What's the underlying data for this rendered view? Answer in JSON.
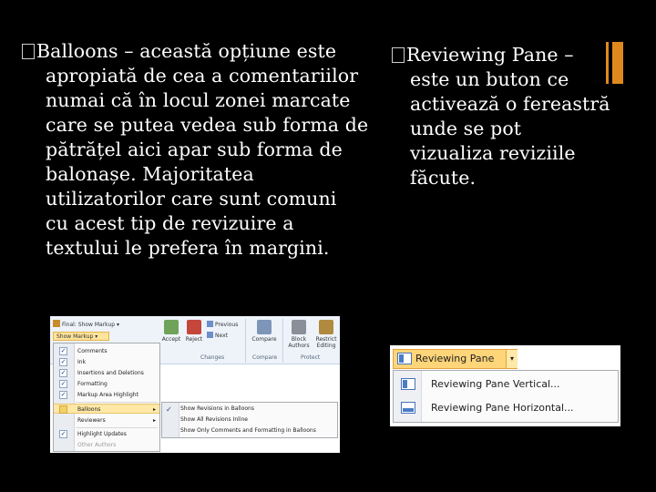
{
  "colors": {
    "background": "#000000",
    "accent": "#e08a1e",
    "text": "#ffffff"
  },
  "left_block": {
    "lines": [
      "Balloons – această opțiune este",
      "apropiată de cea a comentariilor",
      "numai că în locul zonei marcate",
      "care se putea vedea sub forma de",
      "pătrățel aici apar sub forma de",
      "balonașe. Majoritatea",
      "utilizatorilor care sunt comuni",
      "cu acest tip de  revizuire a",
      "textului le prefera în margini."
    ]
  },
  "right_block": {
    "lines": [
      "Reviewing Pane –",
      "este un buton ce",
      "activează o fereastră",
      "unde se pot",
      "vizualiza reviziile",
      "făcute."
    ]
  },
  "shot1": {
    "final_show_markup": "Final: Show Markup",
    "show_markup": "Show Markup",
    "ribbon_buttons": {
      "accept": "Accept",
      "reject": "Reject",
      "previous": "Previous",
      "next": "Next",
      "compare": "Compare",
      "block_authors": "Block Authors",
      "restrict_editing": "Restrict Editing"
    },
    "group_labels": {
      "changes": "Changes",
      "compare": "Compare",
      "protect": "Protect"
    },
    "menu_items": [
      {
        "label": "Comments",
        "checked": true
      },
      {
        "label": "Ink",
        "checked": true
      },
      {
        "label": "Insertions and Deletions",
        "checked": true
      },
      {
        "label": "Formatting",
        "checked": true
      },
      {
        "label": "Markup Area Highlight",
        "checked": true
      },
      {
        "label": "Balloons",
        "checked": false
      },
      {
        "label": "Reviewers",
        "checked": false
      },
      {
        "label": "Highlight Updates",
        "checked": true
      },
      {
        "label": "Other Authors",
        "checked": false
      }
    ],
    "submenu_items": [
      "Show Revisions in Balloons",
      "Show All Revisions Inline",
      "Show Only Comments and Formatting in Balloons"
    ]
  },
  "shot2": {
    "button_label": "Reviewing Pane",
    "menu_items": [
      "Reviewing Pane Vertical...",
      "Reviewing Pane Horizontal..."
    ]
  }
}
